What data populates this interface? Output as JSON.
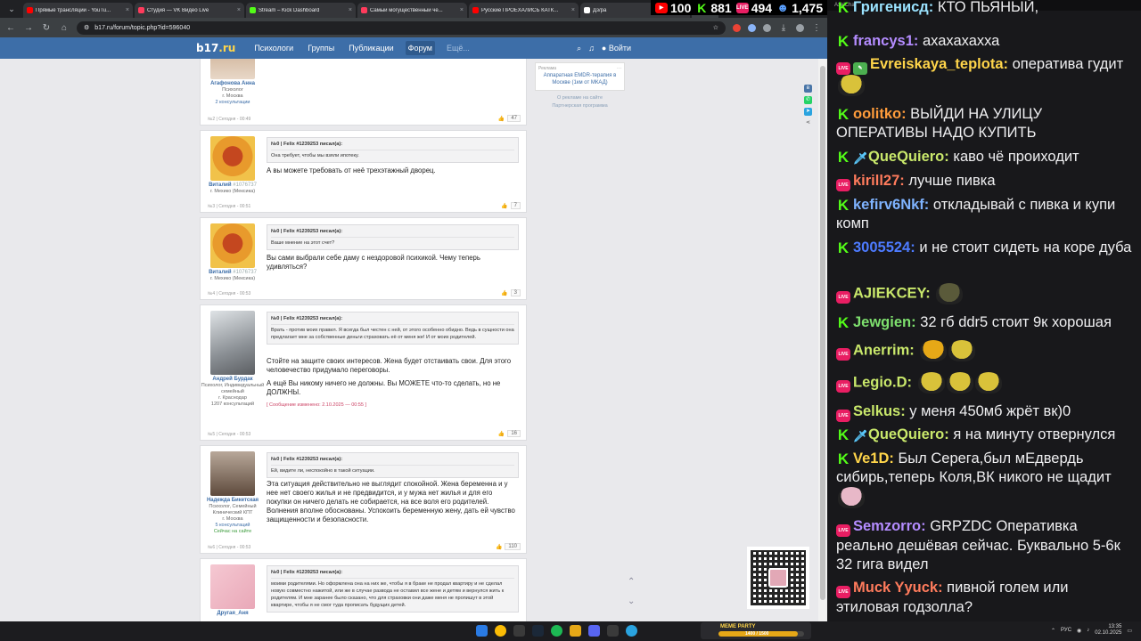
{
  "browser": {
    "tabs": [
      {
        "title": "Прямые трансляции - YouTu...",
        "color": "#ff0000"
      },
      {
        "title": "Студия — VK Видео Live",
        "color": "#ff3b5c"
      },
      {
        "title": "Stream – Kick Dashboard",
        "color": "#53fc18"
      },
      {
        "title": "Самый могущественный че...",
        "color": "#ff3b5c"
      },
      {
        "title": "Русские ПРОЕХАЛИСЬ КАТК...",
        "color": "#ff0000"
      },
      {
        "title": "Дз/pa",
        "color": "#ffffff"
      },
      {
        "title": "До",
        "color": "#4a8fe8"
      }
    ],
    "url": "b17.ru/forum/topic.php?id=596040"
  },
  "overlay": {
    "youtube": "100",
    "kick": "881",
    "vk": "494",
    "total": "1,475"
  },
  "site": {
    "logo_b": "b17",
    "logo_r": ".ru",
    "nav": [
      "Психологи",
      "Группы",
      "Публикации",
      "Форум",
      "Ещё..."
    ],
    "login": "Войти"
  },
  "ad": {
    "label": "Реклама",
    "text": "Аппаратная EMDR-терапия в Москве (1км от МКАД)",
    "about": "О рекламе на сайте",
    "partner": "Партнерская программа"
  },
  "posts": [
    {
      "name": "Агафонова Анна",
      "uid": "",
      "role": "Психолог",
      "city": "г. Москва",
      "extra": "2 консультации",
      "online": "",
      "quote_head": "",
      "quote": "",
      "text": "",
      "edited": "",
      "meta": "№2 | Сегодня - 00:49",
      "likes": "47"
    },
    {
      "name": "Виталий",
      "uid": "#1076737",
      "role": "",
      "city": "г. Мехико (Мексика)",
      "extra": "",
      "online": "",
      "quote_head": "№0 | Felix #1239253 писал(а):",
      "quote": "Она требует, чтобы мы взяли ипотеку.",
      "text": "А вы можете требовать от неё трехэтажный дворец.",
      "edited": "",
      "meta": "№3 | Сегодня - 00:51",
      "likes": "7"
    },
    {
      "name": "Виталий",
      "uid": "#1076737",
      "role": "",
      "city": "г. Мехико (Мексика)",
      "extra": "",
      "online": "",
      "quote_head": "№0 | Felix #1239253 писал(а):",
      "quote": "Ваше мнение на этот счет?",
      "text": "Вы сами выбрали себе даму с нездоровой психикой. Чему теперь удивляться?",
      "edited": "",
      "meta": "№4 | Сегодня - 00:53",
      "likes": "3"
    },
    {
      "name": "Андрей Бурдак",
      "uid": "",
      "role": "Психолог, Индивидуальный семейный",
      "city": "г. Краснодар",
      "extra": "1207 консультаций",
      "online": "",
      "quote_head": "№0 | Felix #1239253 писал(а):",
      "quote": "Врать - против моих правил. Я всегда был честен с ней, от этого особенно обидно. Ведь в сущности она предлагает мне за собственные деньги страховать её от меня же! И от моих родителей.",
      "text": "Стойте на защите своих интересов. Жена будет отстаивать свои. Для этого человечество придумало переговоры.",
      "text2": "А ещё Вы никому ничего не должны. Вы МОЖЕТЕ что-то сделать, но не ДОЛЖНЫ.",
      "edited": "[ Сообщение изменено: 2.10.2025 — 00:55 ]",
      "meta": "№5 | Сегодня - 00:53",
      "likes": "16"
    },
    {
      "name": "Надежда Бикетская",
      "uid": "",
      "role": "Психолог, Семейный Клинический КПТ",
      "city": "г. Москва",
      "extra": "5 консультаций",
      "online": "Сейчас на сайте",
      "quote_head": "№0 | Felix #1239253 писал(а):",
      "quote": "Ей, видите ли, неспокойно в такой ситуации.",
      "text": "Эта ситуация действительно не выглядит спокойной. Жена беременна и у нее нет своего жилья и не предвидится, и у мужа нет жилья и для его покупки он ничего делать не собирается, на все воля его родителей. Волнения вполне обоснованы. Успокоить беременную жену, дать ей чувство защищенности и безопасности.",
      "edited": "",
      "meta": "№6 | Сегодня - 00:53",
      "likes": "110"
    },
    {
      "name": "Другая_Аня",
      "uid": "",
      "role": "",
      "city": "",
      "extra": "",
      "online": "",
      "quote_head": "№0 | Felix #1239253 писал(а):",
      "quote": "моими родителями. Но оформлена она на них же, чтобы я в браке не продал квартиру и не сделал новую совместно нажитой, или же в случае развода не оставил все жене и детям и вернулся жить к родителям. И мне заранее было сказано, что для страховки они даже меня не пропишут в этой квартире, чтобы я не смог туда прописать будущих детей.",
      "text": "",
      "edited": "",
      "meta": "",
      "likes": ""
    }
  ],
  "chat": {
    "title": "AxelChat",
    "messages": [
      {
        "badge": "k",
        "nick": "Григенисд:",
        "color": "#9be3ff",
        "text": "КТО ПЬЯНЫЙ,"
      },
      {
        "badge": "k",
        "nick": "francys1:",
        "color": "#b48cff",
        "text": "ахахахахха"
      },
      {
        "badge": "live-pen",
        "nick": "Evreiskaya_teplota:",
        "color": "#ffd54a",
        "text": "оператива гудит"
      },
      {
        "badge": "k",
        "nick": "oolitko:",
        "color": "#ff9c3b",
        "text": "ВЫЙДИ НА УЛИЦУ ОПЕРАТИВЫ НАДО КУПИТЬ"
      },
      {
        "badge": "k-sword",
        "nick": "QueQuiero:",
        "color": "#c9e86b",
        "text": "каво чё проиходит"
      },
      {
        "badge": "live",
        "nick": "kirill27:",
        "color": "#ff7b5c",
        "text": "лучше пивка"
      },
      {
        "badge": "k",
        "nick": "kefirv6Nkf:",
        "color": "#7fb3ff",
        "text": "откладывай с пивка и купи комп"
      },
      {
        "badge": "k",
        "nick": "3005524:",
        "color": "#4d7bff",
        "text": "и не стоит сидеть на коре дуба"
      },
      {
        "badge": "live",
        "nick": "AJIEKCEY:",
        "color": "#c9e86b",
        "text": ""
      },
      {
        "badge": "k",
        "nick": "Jewgien:",
        "color": "#7ee06e",
        "text": "32 гб ddr5 стоит 9к хорошая"
      },
      {
        "badge": "live",
        "nick": "Anerrim:",
        "color": "#c9e86b",
        "text": ""
      },
      {
        "badge": "live",
        "nick": "Legio.D:",
        "color": "#c9e86b",
        "text": ""
      },
      {
        "badge": "live",
        "nick": "Selkus:",
        "color": "#c9e86b",
        "text": "у меня 450мб жрёт вк)0"
      },
      {
        "badge": "k-sword",
        "nick": "QueQuiero:",
        "color": "#c9e86b",
        "text": "я на минуту отвернулся"
      },
      {
        "badge": "k",
        "nick": "Ve1D:",
        "color": "#ffd54a",
        "text": "Был Серега,был мЕдвердь сибирь,теперь Коля,ВК никого не щадит"
      },
      {
        "badge": "live",
        "nick": "Semzorro:",
        "color": "#b48cff",
        "text": "GRPZDC Оперативка реально дешёвая сейчас. Буквально 5-6к 32 гига видел"
      },
      {
        "badge": "live",
        "nick": "Muck Yyuck:",
        "color": "#ff7b5c",
        "text": "пивной голем или этиловая годзолла?"
      }
    ]
  },
  "taskbar": {
    "meme_title": "MEME PARTY",
    "meme_progress": "1400 / 1500",
    "meme_fraction": 0.93,
    "lang": "РУС",
    "time": "13:35",
    "date": "02.10.2025"
  }
}
